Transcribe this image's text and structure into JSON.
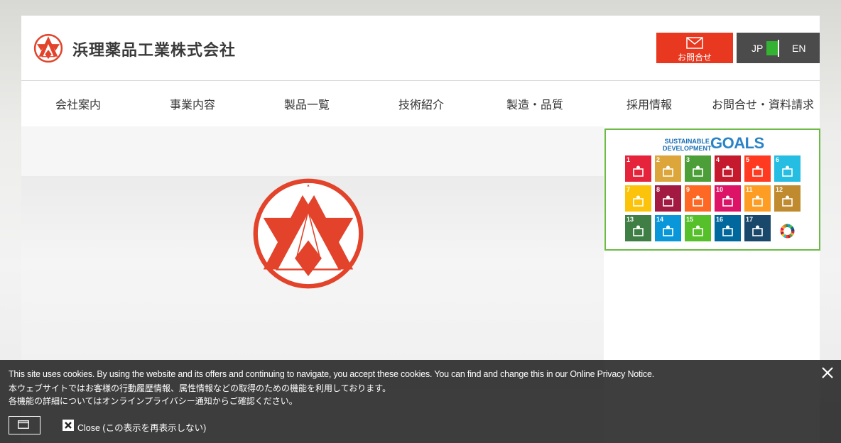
{
  "header": {
    "company_name": "浜理薬品工業株式会社",
    "contact_label": "お問合せ",
    "lang_jp": "JP",
    "lang_en": "EN"
  },
  "nav": {
    "items": [
      "会社案内",
      "事業内容",
      "製品一覧",
      "技術紹介",
      "製造・品質",
      "採用情報",
      "お問合せ・資料請求"
    ]
  },
  "sdg_banner": {
    "title_small": "SUSTAINABLE\nDEVELOPMENT",
    "title_large": "GOALS",
    "goals": [
      {
        "num": "1",
        "color": "#e5243b"
      },
      {
        "num": "2",
        "color": "#dda63a"
      },
      {
        "num": "3",
        "color": "#4c9f38"
      },
      {
        "num": "4",
        "color": "#c5192d"
      },
      {
        "num": "5",
        "color": "#ff3a21"
      },
      {
        "num": "6",
        "color": "#26bde2"
      },
      {
        "num": "7",
        "color": "#fcc30b"
      },
      {
        "num": "8",
        "color": "#a21942"
      },
      {
        "num": "9",
        "color": "#fd6925"
      },
      {
        "num": "10",
        "color": "#dd1367"
      },
      {
        "num": "11",
        "color": "#fd9d24"
      },
      {
        "num": "12",
        "color": "#bf8b2e"
      },
      {
        "num": "13",
        "color": "#3f7e44"
      },
      {
        "num": "14",
        "color": "#0a97d9"
      },
      {
        "num": "15",
        "color": "#56c02b"
      },
      {
        "num": "16",
        "color": "#00689d"
      },
      {
        "num": "17",
        "color": "#19486a"
      },
      {
        "num": "",
        "color": "#ffffff"
      }
    ]
  },
  "cookie": {
    "line1": "This site uses cookies. By using the website and its offers and continuing to navigate, you accept these cookies. You can find and change this in our Online Privacy Notice.",
    "line2": "本ウェブサイトではお客様の行動履歴情報、属性情報などの取得のための機能を利用しております。",
    "line3": "各機能の詳細についてはオンラインプライバシー通知からご確認ください。",
    "close_label": "Close (この表示を再表示しない)"
  },
  "colors": {
    "brand_red": "#e8381f",
    "lang_bg": "#4b4b4b",
    "lang_active": "#34b232",
    "sdg_border": "#6cbb47"
  },
  "icons": [
    "brand-logo-icon",
    "mail-icon",
    "close-icon",
    "window-icon",
    "x-box-icon"
  ]
}
